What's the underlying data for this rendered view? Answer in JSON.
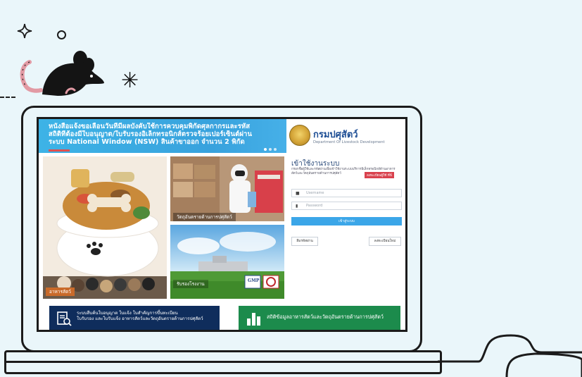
{
  "banner": {
    "lines": [
      "หนังสือแจ้งขอเลื่อนวันที่มีผลบังคับใช้การควบคุมพิกัดศุลกากรและรหัส",
      "สถิติที่ต้องมีใบอนุญาต/ใบรับรองอิเล็กทรอนิกส์ตรวจร้อยเปอร์เซ็นต์ผ่าน",
      "ระบบ National Window (NSW) สินค้าขาออก จำนวน 2 พิกัด"
    ]
  },
  "logo": {
    "title": "กรมปศุสัตว์",
    "subtitle": "Department Of Livestock Development"
  },
  "tiles": {
    "food_label": "อาหารสัตว์",
    "hazard_label": "วัตถุอันตรายด้านการปศุสัตว์",
    "factory_label": "รับรองโรงงาน"
  },
  "login": {
    "title": "เข้าใช้งานระบบ",
    "description": "กรอกชื่อผู้ใช้และรหัสผ่านเพื่อเข้าใช้งานระบบบริการอิเล็กทรอนิกส์ด้านอาหารสัตว์และวัตถุอันตรายด้านการปศุสัตว์",
    "register_badge": "ลงทะเบียนผู้ใช้ ที่นี่",
    "username_placeholder": "Username",
    "password_placeholder": "Password",
    "login_button": "เข้าสู่ระบบ",
    "forgot_button": "ลืมรหัสผ่าน",
    "register_button": "ลงทะเบียนใหม่"
  },
  "bottom": {
    "left_line1": "ระบบสืบค้นใบอนุญาต ใบแจ้ง ใบสำคัญการขึ้นทะเบียน",
    "left_line2": "ใบรับรอง และใบรับแจ้ง อาหารสัตว์และวัตถุอันตรายด้านการปศุสัตว์",
    "right_text": "สถิติข้อมูลอาหารสัตว์และวัตถุอันตรายด้านการปศุสัตว์"
  },
  "colors": {
    "banner_blue": "#3db3e6",
    "dark_navy": "#0f2d5c",
    "green": "#1c8b4c",
    "login_blue": "#3ba6e8",
    "register_red": "#d9414d"
  }
}
